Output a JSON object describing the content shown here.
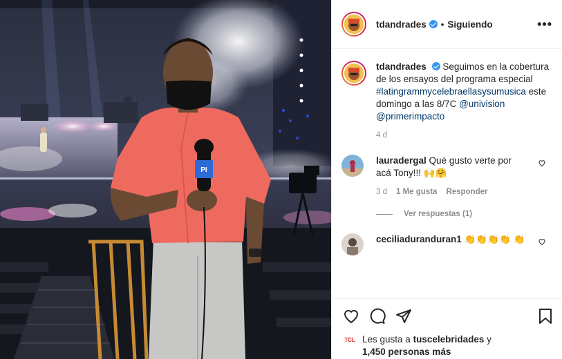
{
  "post": {
    "author": "tdandrades",
    "follow_status": "Siguiendo",
    "more_label": "•••"
  },
  "caption": {
    "author": "tdandrades",
    "text": "Seguimos en la cobertura de los ensayos del programa especial",
    "hashtag": "#latingrammycelebraellasysumusica",
    "text2": "este domingo a las 8/7C",
    "mention1": "@univision",
    "mention2": "@primerimpacto",
    "age": "4 d"
  },
  "comments": [
    {
      "author": "lauradergal",
      "text": "Qué gusto verte por acá Tony!!! 🙌🤗",
      "age": "3 d",
      "likes": "1 Me gusta",
      "reply_label": "Responder",
      "replies_label": "Ver respuestas (1)"
    },
    {
      "author": "ceciliaduranduran1",
      "text": "👏👏👏👏 👏"
    }
  ],
  "likes": {
    "prefix": "Les gusta a",
    "user": "tuscelebridades",
    "suffix": "y",
    "count": "1,450 personas más",
    "badge": "TCL"
  },
  "photo": {
    "mic_logo": "PI"
  },
  "colors": {
    "shirt": "#ef6a5e",
    "link": "#00376b",
    "verified": "#3897f0"
  }
}
